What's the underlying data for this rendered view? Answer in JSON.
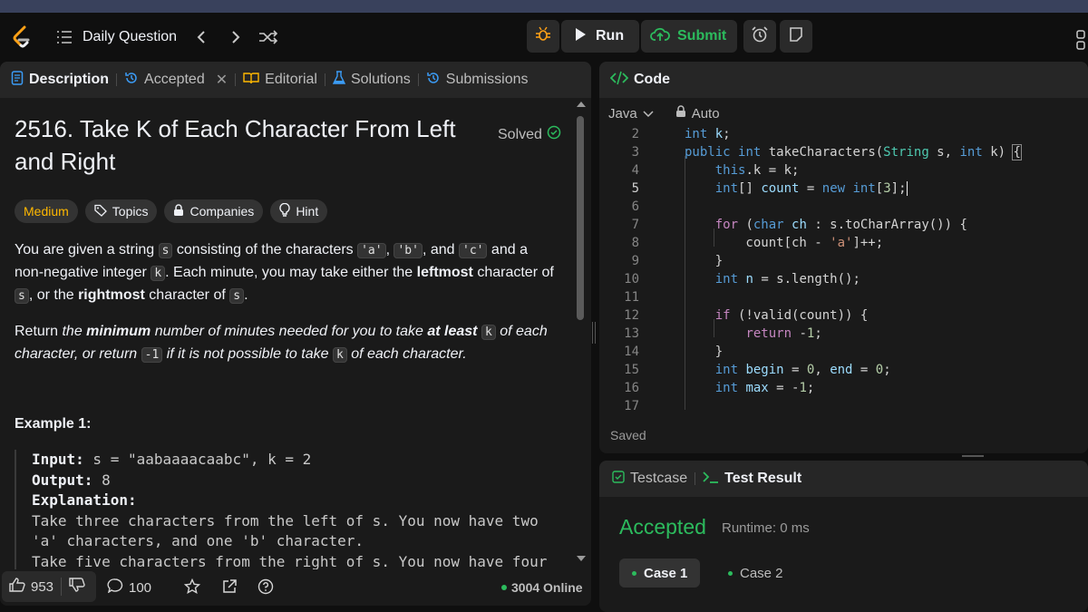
{
  "topbar": {
    "daily_question": "Daily Question",
    "run_label": "Run",
    "submit_label": "Submit"
  },
  "left_tabs": {
    "description": "Description",
    "accepted": "Accepted",
    "editorial": "Editorial",
    "solutions": "Solutions",
    "submissions": "Submissions"
  },
  "problem": {
    "title": "2516. Take K of Each Character From Left and Right",
    "solved": "Solved",
    "difficulty": "Medium",
    "topics": "Topics",
    "companies": "Companies",
    "hint": "Hint",
    "p1": {
      "t1": "You are given a string ",
      "c1": "s",
      "t2": " consisting of the characters ",
      "c2": "'a'",
      "t3": ", ",
      "c3": "'b'",
      "t4": ", and ",
      "c4": "'c'",
      "t5": " and a non-negative integer ",
      "c5": "k",
      "t6": ". Each minute, you may take either the ",
      "b1": "leftmost",
      "t7": " character of ",
      "c6": "s",
      "t8": ", or the ",
      "b2": "rightmost",
      "t9": " character of ",
      "c7": "s",
      "t10": "."
    },
    "p2": {
      "t1": "Return ",
      "i1": "the ",
      "b1": "minimum",
      "t2": " number of minutes needed for you to take ",
      "b2": "at least",
      "t3": " ",
      "c1": "k",
      "t4": " of each character, or return ",
      "c2": "-1",
      "t5": " if it is not possible to take ",
      "c3": "k",
      "t6": " of each character."
    },
    "example_title": "Example 1:",
    "example": {
      "input_label": "Input:",
      "input_value": " s = \"aabaaaacaabc\", k = 2",
      "output_label": "Output:",
      "output_value": " 8",
      "explanation_label": "Explanation:",
      "line1": "Take three characters from the left of s. You now have two",
      "line2": "'a' characters, and one 'b' character.",
      "line3": "Take five characters from the right of s. You now have four"
    }
  },
  "footer": {
    "likes": "953",
    "comments": "100",
    "online": "3004 Online"
  },
  "code_panel": {
    "title": "Code",
    "language": "Java",
    "mode": "Auto",
    "saved": "Saved",
    "line_numbers": [
      "2",
      "3",
      "4",
      "5",
      "6",
      "7",
      "8",
      "9",
      "10",
      "11",
      "12",
      "13",
      "14",
      "15",
      "16",
      "17"
    ]
  },
  "test_panel": {
    "testcase_tab": "Testcase",
    "result_tab": "Test Result",
    "status": "Accepted",
    "runtime": "Runtime: 0 ms",
    "case1": "Case 1",
    "case2": "Case 2"
  },
  "colors": {
    "accent_green": "#2cbb5d",
    "medium": "#ffb800",
    "background": "#0f0f0f",
    "panel": "#1a1a1a"
  }
}
